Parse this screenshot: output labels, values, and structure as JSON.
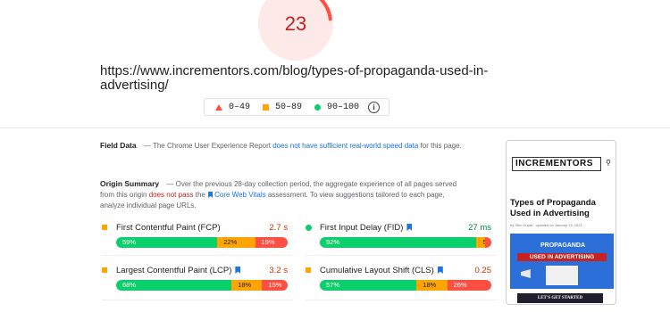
{
  "score": {
    "value": "23",
    "fraction": 0.23,
    "color": "#c7221f"
  },
  "url": "https://www.incrementors.com/blog/types-of-propaganda-used-in-advertising/",
  "legend": [
    {
      "icon": "triangle-icon",
      "label": "0–49"
    },
    {
      "icon": "square-icon",
      "label": "50–89"
    },
    {
      "icon": "circle-icon",
      "label": "90–100"
    }
  ],
  "field_data": {
    "title": "Field Data",
    "text1": "— The Chrome User Experience Report",
    "link": "does not have sufficient real-world speed data",
    "text2": "for this page."
  },
  "origin_summary": {
    "title": "Origin Summary",
    "text1": "— Over the previous 28-day collection period, the aggregate experience of all pages served from this origin",
    "fail": "does not pass",
    "text2": "the",
    "cwv": "Core Web Vitals",
    "text3": "assessment. To view suggestions tailored to each page, analyze individual page URLs."
  },
  "metrics": [
    {
      "name": "First Contentful Paint (FCP)",
      "value": "2.7 s",
      "status": "average",
      "cwv": false,
      "dist": [
        "59%",
        "22%",
        "19%"
      ]
    },
    {
      "name": "First Input Delay (FID)",
      "value": "27 ms",
      "status": "good",
      "cwv": true,
      "dist": [
        "92%",
        "5%",
        "2%"
      ]
    },
    {
      "name": "Largest Contentful Paint (LCP)",
      "value": "3.2 s",
      "status": "average",
      "cwv": true,
      "dist": [
        "68%",
        "18%",
        "15%"
      ]
    },
    {
      "name": "Cumulative Layout Shift (CLS)",
      "value": "0.25",
      "status": "average",
      "cwv": true,
      "dist": [
        "57%",
        "18%",
        "26%"
      ]
    }
  ],
  "thumbnail": {
    "logo": "INCREMENTORS",
    "title": "Types of Propaganda Used in Advertising",
    "meta": "by Shiv Gupta · updated on January 13, 2021",
    "hero_line1": "PROPAGANDA",
    "hero_line2": "USED IN ADVERTISING",
    "cta": "LET'S GET STARTED"
  },
  "colors": {
    "poor": "#ff4e42",
    "average": "#ffa400",
    "good": "#0cce6b",
    "link": "#1a73e8"
  }
}
